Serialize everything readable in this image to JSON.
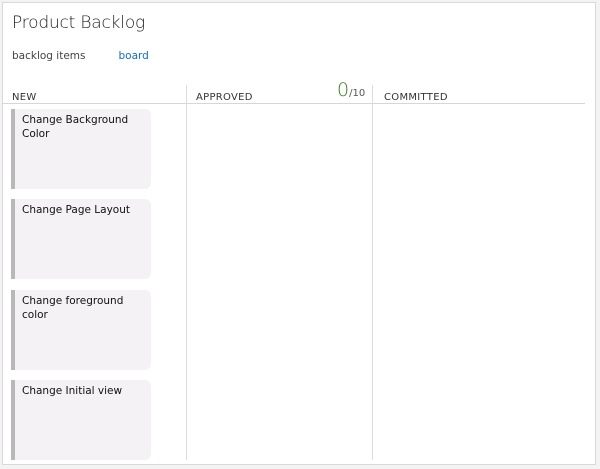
{
  "page": {
    "title": "Product Backlog",
    "views": [
      {
        "label": "backlog items",
        "active": true
      },
      {
        "label": "board",
        "active": false
      }
    ]
  },
  "columns": [
    {
      "name": "NEW"
    },
    {
      "name": "APPROVED",
      "wip_count": "0",
      "wip_limit": "/10"
    },
    {
      "name": "COMMITTED"
    }
  ],
  "cards": [
    {
      "title": "Change Background Color"
    },
    {
      "title": "Change Page Layout"
    },
    {
      "title": "Change foreground color"
    },
    {
      "title": "Change Initial view"
    }
  ],
  "colors": {
    "link": "#106ebe",
    "wip": "#3a7a1e",
    "card_bg": "#f5f2f5",
    "card_bar": "#b8b8b8"
  }
}
